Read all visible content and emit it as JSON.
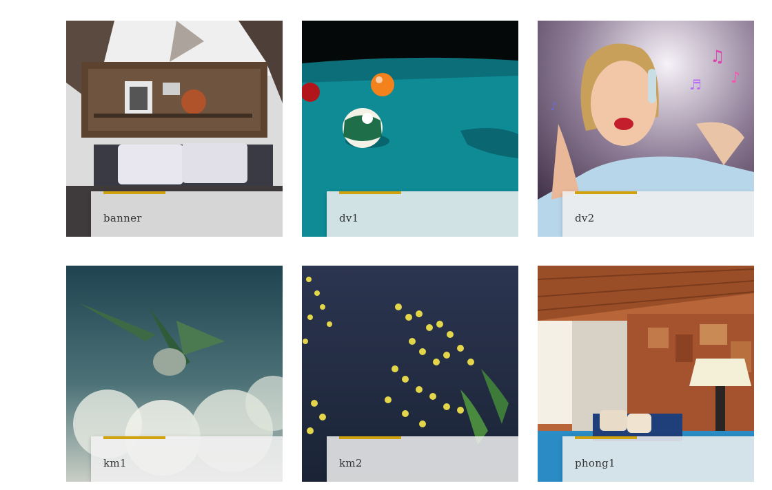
{
  "colors": {
    "accent": "#cfa20e",
    "caption_bg": "#f0f0f0",
    "text": "#333333"
  },
  "gallery": {
    "items": [
      {
        "label": "banner",
        "image": "bedroom-photo"
      },
      {
        "label": "dv1",
        "image": "billiard-balls-photo"
      },
      {
        "label": "dv2",
        "image": "girl-headphones-music-photo"
      },
      {
        "label": "km1",
        "image": "frosted-plant-photo"
      },
      {
        "label": "km2",
        "image": "yellow-mimosa-flowers-photo"
      },
      {
        "label": "phong1",
        "image": "wooden-room-photo"
      }
    ]
  }
}
